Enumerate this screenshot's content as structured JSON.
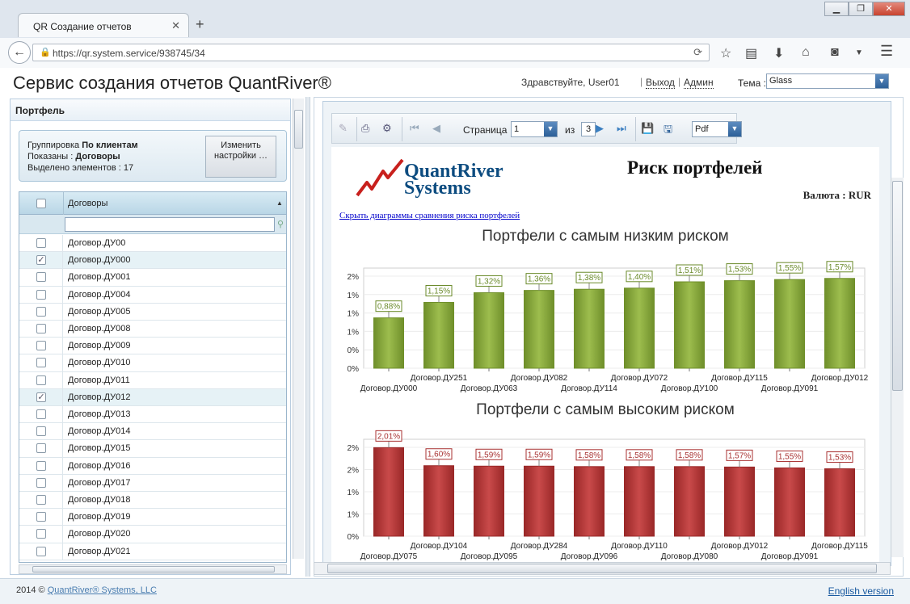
{
  "browser": {
    "tab_title": "QR Создание отчетов",
    "url": "https://qr.system.service/938745/34"
  },
  "header": {
    "title": "Сервис создания отчетов QuantRiver®",
    "greeting": "Здравствуйте, User01",
    "logout": "Выход",
    "admin": "Админ",
    "theme_label": "Тема :",
    "theme_value": "Glass"
  },
  "portfolio": {
    "title": "Портфель",
    "grouping_label": "Группировка",
    "grouping_value": "По клиентам",
    "shown_label": "Показаны :",
    "shown_value": "Договоры",
    "selected_label": "Выделено элементов :",
    "selected_value": "17",
    "change_button": "Изменить настройки …",
    "column_header": "Договоры",
    "rows": [
      {
        "label": "Договор.ДУ00",
        "checked": false
      },
      {
        "label": "Договор.ДУ000",
        "checked": true
      },
      {
        "label": "Договор.ДУ001",
        "checked": false
      },
      {
        "label": "Договор.ДУ004",
        "checked": false
      },
      {
        "label": "Договор.ДУ005",
        "checked": false
      },
      {
        "label": "Договор.ДУ008",
        "checked": false
      },
      {
        "label": "Договор.ДУ009",
        "checked": false
      },
      {
        "label": "Договор.ДУ010",
        "checked": false
      },
      {
        "label": "Договор.ДУ011",
        "checked": false
      },
      {
        "label": "Договор.ДУ012",
        "checked": true
      },
      {
        "label": "Договор.ДУ013",
        "checked": false
      },
      {
        "label": "Договор.ДУ014",
        "checked": false
      },
      {
        "label": "Договор.ДУ015",
        "checked": false
      },
      {
        "label": "Договор.ДУ016",
        "checked": false
      },
      {
        "label": "Договор.ДУ017",
        "checked": false
      },
      {
        "label": "Договор.ДУ018",
        "checked": false
      },
      {
        "label": "Договор.ДУ019",
        "checked": false
      },
      {
        "label": "Договор.ДУ020",
        "checked": false
      },
      {
        "label": "Договор.ДУ021",
        "checked": false
      }
    ]
  },
  "report": {
    "page_label": "Страница",
    "page_value": "1",
    "of_label": "из",
    "page_total": "3",
    "format_value": "Pdf",
    "logo_line1": "QuantRiver",
    "logo_line2": "Systems",
    "title": "Риск портфелей",
    "currency": "Валюта : RUR",
    "toggle_link": "Скрыть диаграммы сравнения риска портфелей"
  },
  "colors": {
    "green_bar": "#8aab3c",
    "red_bar": "#b83a3a",
    "accent": "#2d6098"
  },
  "chart_data": [
    {
      "type": "bar",
      "title": "Портфели с самым низким риском",
      "categories": [
        "Договор.ДУ000",
        "Договор.ДУ251",
        "Договор.ДУ063",
        "Договор.ДУ082",
        "Договор.ДУ114",
        "Договор.ДУ072",
        "Договор.ДУ100",
        "Договор.ДУ115",
        "Договор.ДУ091",
        "Договор.ДУ012"
      ],
      "values": [
        0.88,
        1.15,
        1.32,
        1.36,
        1.38,
        1.4,
        1.51,
        1.53,
        1.55,
        1.57
      ],
      "data_labels": [
        "0,88%",
        "1,15%",
        "1,32%",
        "1,36%",
        "1,38%",
        "1,40%",
        "1,51%",
        "1,53%",
        "1,55%",
        "1,57%"
      ],
      "y_tick_labels": [
        "0%",
        "0%",
        "1%",
        "1%",
        "1%",
        "2%"
      ],
      "ylim": [
        0,
        1.75
      ],
      "grid": true
    },
    {
      "type": "bar",
      "title": "Портфели с самым высоким риском",
      "categories": [
        "Договор.ДУ075",
        "Договор.ДУ104",
        "Договор.ДУ095",
        "Договор.ДУ284",
        "Договор.ДУ096",
        "Договор.ДУ110",
        "Договор.ДУ080",
        "Договор.ДУ012",
        "Договор.ДУ091",
        "Договор.ДУ115"
      ],
      "values": [
        2.01,
        1.6,
        1.59,
        1.59,
        1.58,
        1.58,
        1.58,
        1.57,
        1.55,
        1.53
      ],
      "data_labels": [
        "2,01%",
        "1,60%",
        "1,59%",
        "1,59%",
        "1,58%",
        "1,58%",
        "1,58%",
        "1,57%",
        "1,55%",
        "1,53%"
      ],
      "y_tick_labels": [
        "0%",
        "1%",
        "1%",
        "2%",
        "2%"
      ],
      "ylim": [
        0,
        2.2
      ],
      "grid": true
    }
  ],
  "footer": {
    "year": "2014 ©",
    "company": "QuantRiver® Systems, LLC",
    "english": "English version"
  }
}
